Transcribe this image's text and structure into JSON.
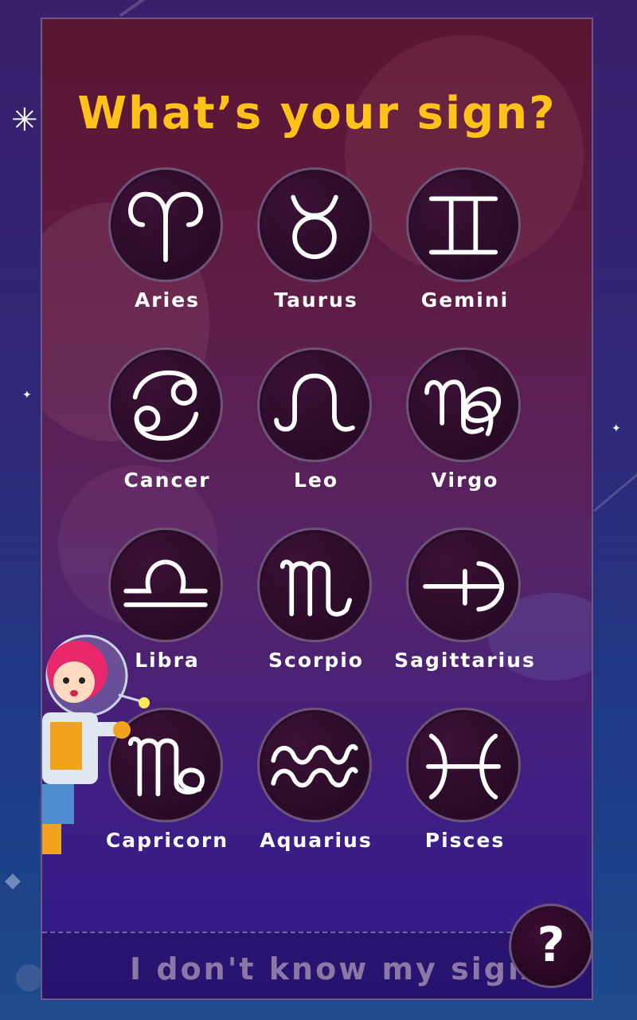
{
  "title": "What’s your sign?",
  "signs": [
    {
      "label": "Aries",
      "icon": "aries-icon"
    },
    {
      "label": "Taurus",
      "icon": "taurus-icon"
    },
    {
      "label": "Gemini",
      "icon": "gemini-icon"
    },
    {
      "label": "Cancer",
      "icon": "cancer-icon"
    },
    {
      "label": "Leo",
      "icon": "leo-icon"
    },
    {
      "label": "Virgo",
      "icon": "virgo-icon"
    },
    {
      "label": "Libra",
      "icon": "libra-icon"
    },
    {
      "label": "Scorpio",
      "icon": "scorpio-icon"
    },
    {
      "label": "Sagittarius",
      "icon": "sagittarius-icon"
    },
    {
      "label": "Capricorn",
      "icon": "capricorn-icon"
    },
    {
      "label": "Aquarius",
      "icon": "aquarius-icon"
    },
    {
      "label": "Pisces",
      "icon": "pisces-icon"
    }
  ],
  "unknown_label": "I don't know my sign",
  "help_label": "?",
  "colors": {
    "title": "#ffc21a",
    "label": "#ffffff",
    "muted": "#8b78a6"
  }
}
